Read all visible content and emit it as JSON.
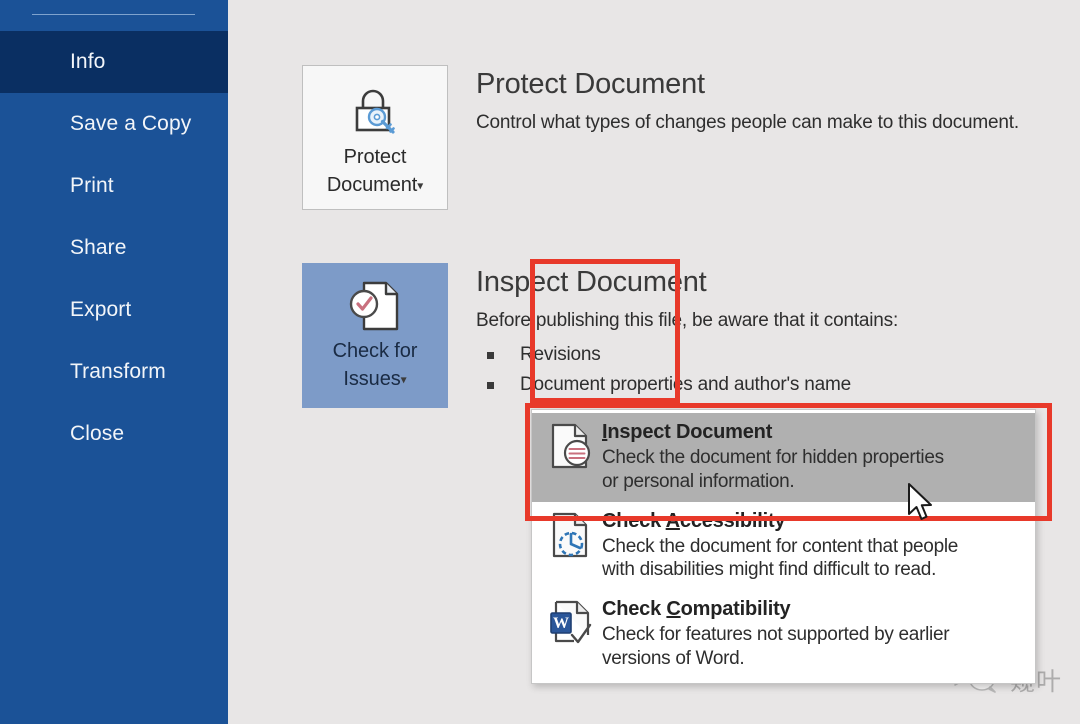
{
  "app": {
    "name": "Microsoft Word Backstage",
    "accent_blue": "#1B5297",
    "selected_nav_blue": "#0A2F62",
    "content_background": "#E8E6E6",
    "annotation_red": "#E8392A",
    "highlight_button_blue": "#7D9BC8",
    "menu_hover_gray": "#B0B0B0"
  },
  "sidebar": {
    "items": [
      {
        "label": "Info",
        "selected": true
      },
      {
        "label": "Save a Copy",
        "selected": false
      },
      {
        "label": "Print",
        "selected": false
      },
      {
        "label": "Share",
        "selected": false
      },
      {
        "label": "Export",
        "selected": false
      },
      {
        "label": "Transform",
        "selected": false
      },
      {
        "label": "Close",
        "selected": false
      }
    ]
  },
  "protect_section": {
    "button": {
      "label_line1": "Protect",
      "label_line2": "Document",
      "caret": "▾",
      "icon": "lock-key-icon"
    },
    "title": "Protect Document",
    "description": "Control what types of changes people can make to this document."
  },
  "inspect_section": {
    "button": {
      "label_line1": "Check for",
      "label_line2": "Issues",
      "caret": "▾",
      "icon": "document-check-icon",
      "highlighted": true
    },
    "title": "Inspect Document",
    "description": "Before publishing this file, be aware that it contains:",
    "bullets": [
      "Revisions",
      "Document properties and author's name"
    ]
  },
  "dropdown": {
    "items": [
      {
        "title_before": "",
        "title_accel": "I",
        "title_after": "nspect Document",
        "desc_line1": "Check the document for hidden properties",
        "desc_line2": "or personal information.",
        "icon": "inspect-document-icon",
        "hovered": true
      },
      {
        "title_before": "Check ",
        "title_accel": "A",
        "title_after": "ccessibility",
        "desc_line1": "Check the document for content that people",
        "desc_line2": "with disabilities might find difficult to read.",
        "icon": "accessibility-check-icon",
        "hovered": false
      },
      {
        "title_before": "Check ",
        "title_accel": "C",
        "title_after": "ompatibility",
        "desc_line1": "Check for features not supported by earlier",
        "desc_line2": "versions of Word.",
        "icon": "word-compatibility-icon",
        "hovered": false
      }
    ]
  },
  "annotations": [
    {
      "name": "check-for-issues-highlight",
      "color": "#E8392A"
    },
    {
      "name": "inspect-document-menu-highlight",
      "color": "#E8392A"
    }
  ],
  "cursor": {
    "type": "arrow-pointer"
  },
  "watermark": {
    "text": "窥叶",
    "icon": "wechat-icon"
  }
}
